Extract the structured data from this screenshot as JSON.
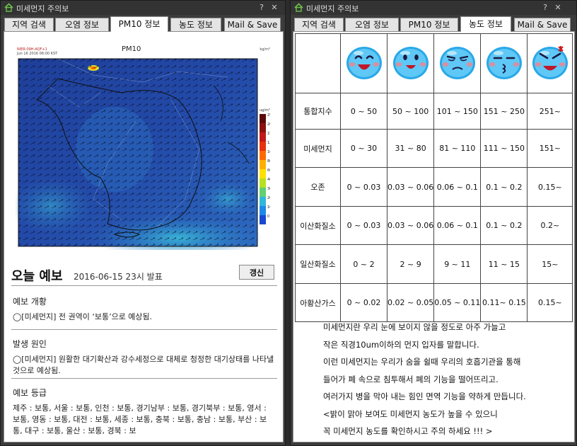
{
  "left_window": {
    "title": "미세먼지 주의보",
    "help_label": "?",
    "close_label": "✕",
    "tabs": [
      "지역 검색",
      "오염 정보",
      "PM10 정보",
      "농도 정보",
      "Mail & Save"
    ],
    "active_tab": "PM10 정보",
    "map": {
      "title": "PM10",
      "run_id": "NIER-09H-AQF+1",
      "datetime": "Jun 16 2016 06:00 KST",
      "unit_top": "ug/m³",
      "unit_corner": "kg/m³",
      "scale_labels": [
        "250",
        "200",
        "150",
        "120",
        "100",
        "80",
        "60",
        "40",
        "30",
        "20",
        "10",
        "0"
      ],
      "scale_colors": [
        "#5a0a0a",
        "#8a1010",
        "#c01818",
        "#e83010",
        "#ff6a00",
        "#ffb000",
        "#ffe000",
        "#b8e020",
        "#60d070",
        "#30b8d8",
        "#2088e8",
        "#1848d0"
      ]
    },
    "forecast": {
      "title": "오늘 예보",
      "date": "2016-06-15 23시 발표",
      "refresh_label": "갱신",
      "overview_title": "예보 개황",
      "overview_text": "◯[미세먼지] 전 권역이 ‘보통’으로 예상됨.",
      "cause_title": "발생 원인",
      "cause_text": "◯[미세먼지] 원활한 대기확산과 강수세정으로 대체로 청정한 대기상태를 나타낼 것으로 예상됨.",
      "grade_title": "예보 등급",
      "grade_text": "제주 : 보통, 서울 : 보통, 인천 : 보통, 경기남부 : 보통, 경기북부 : 보통, 영서 : 보통, 영동 : 보통, 대전 : 보통, 세종 : 보통, 충북 : 보통, 충남 : 보통, 부산 : 보통, 대구 : 보통, 울산 : 보통, 경북 : 보"
    }
  },
  "right_window": {
    "title": "미세먼지 주의보",
    "help_label": "?",
    "close_label": "✕",
    "tabs": [
      "지역 검색",
      "오염 정보",
      "PM10 정보",
      "농도 정보",
      "Mail & Save"
    ],
    "active_tab": "농도 정보",
    "faces": [
      {
        "icon": "very-happy-face-icon",
        "grade": 1
      },
      {
        "icon": "happy-face-icon",
        "grade": 2
      },
      {
        "icon": "worried-face-icon",
        "grade": 3
      },
      {
        "icon": "annoyed-face-icon",
        "grade": 4
      },
      {
        "icon": "angry-face-icon",
        "grade": 5
      }
    ],
    "rows": [
      {
        "label": "통합지수",
        "values": [
          "0 ~ 50",
          "50 ~ 100",
          "101 ~ 150",
          "151 ~ 250",
          "251~"
        ]
      },
      {
        "label": "미세먼지",
        "values": [
          "0 ~ 30",
          "31 ~ 80",
          "81 ~ 110",
          "111 ~ 150",
          "151~"
        ]
      },
      {
        "label": "오존",
        "values": [
          "0 ~ 0.03",
          "0.03 ~ 0.06",
          "0.06 ~ 0.1",
          "0.1 ~ 0.2",
          "0.15~"
        ]
      },
      {
        "label": "이산화질소",
        "values": [
          "0 ~ 0.03",
          "0.03 ~ 0.06",
          "0.06 ~ 0.1",
          "0.1 ~ 0.2",
          "0.2~"
        ]
      },
      {
        "label": "일산화질소",
        "values": [
          "0 ~ 2",
          "2 ~ 9",
          "9 ~ 11",
          "11 ~ 15",
          "15~"
        ]
      },
      {
        "label": "아황산가스",
        "values": [
          "0 ~ 0.02",
          "0.02 ~ 0.05",
          "0.05 ~ 0.11",
          "0.11~ 0.15",
          "0.15~"
        ]
      }
    ],
    "info_lines": [
      "미세먼지란 우리 눈에 보이지 않을 정도로 아주 가늘고",
      "작은 직경10um이하의 먼지 입자를 말합니다.",
      "이런 미세먼지는 우리가 숨을 쉴때 우리의 호흡기관을 통해",
      "들어가 폐 속으로 침투해서 폐의 기능을 떨어뜨리고.",
      "여러가지 병을 막아 내는 힘인 면역 기능을 약하게 만듭니다.",
      "<밝이 맑아 보여도 미세먼지 농도가 높을 수 있으니",
      "꼭 미세먼지 농도를 확인하시고 주의 하세요 !!! >"
    ]
  }
}
